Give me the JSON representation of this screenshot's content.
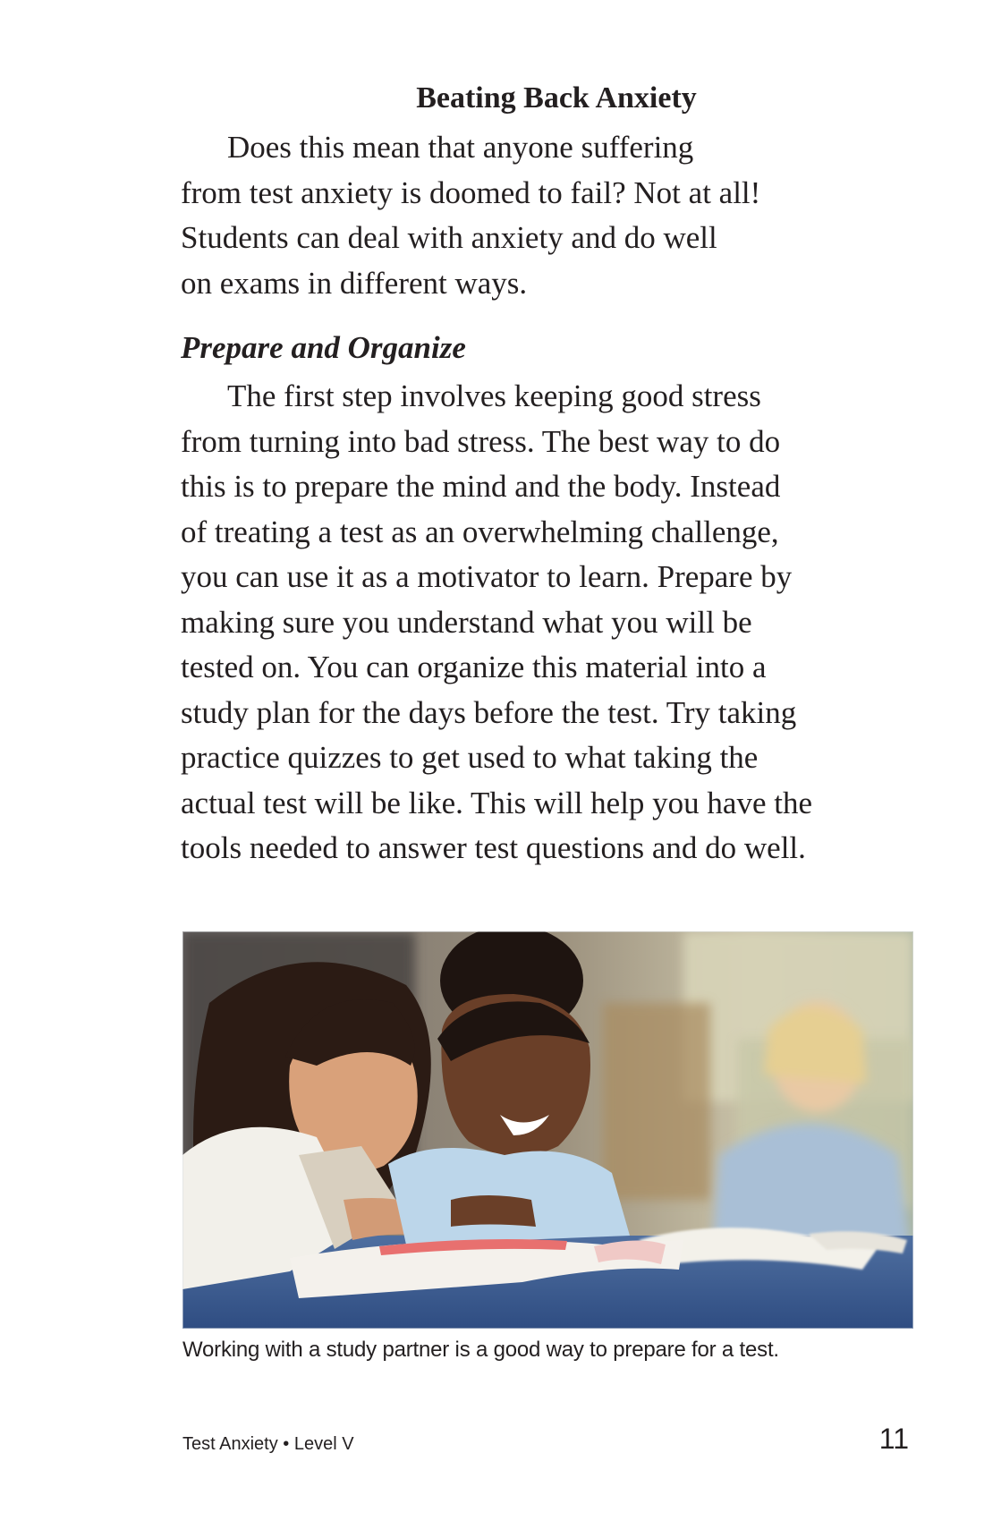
{
  "heading": "Beating Back Anxiety",
  "intro_lines": [
    "Does this mean that anyone suffering",
    "from test anxiety is doomed to fail? Not at all!",
    "Students can deal with anxiety and do well",
    "on exams in different ways."
  ],
  "subheading": "Prepare and Organize",
  "body_lines": [
    "The first step involves keeping good stress",
    "from turning into bad stress. The best way to do",
    "this is to prepare the mind and the body. Instead",
    "of treating a test as an overwhelming challenge,",
    "you can use it as a motivator to learn. Prepare by",
    "making sure you understand what you will be",
    "tested on. You can organize this material into a",
    "study plan for the days before the test. Try taking",
    "practice quizzes to get used to what taking the",
    "actual test will be like. This will help you have the",
    "tools needed to answer test questions and do well."
  ],
  "photo": {
    "alt": "Working with a study partner is a good way to prepare for a test."
  },
  "caption": "Working with a study partner is a good way to prepare for a test.",
  "footer": {
    "book_title": "Test Anxiety • Level V",
    "page_number": "11"
  }
}
